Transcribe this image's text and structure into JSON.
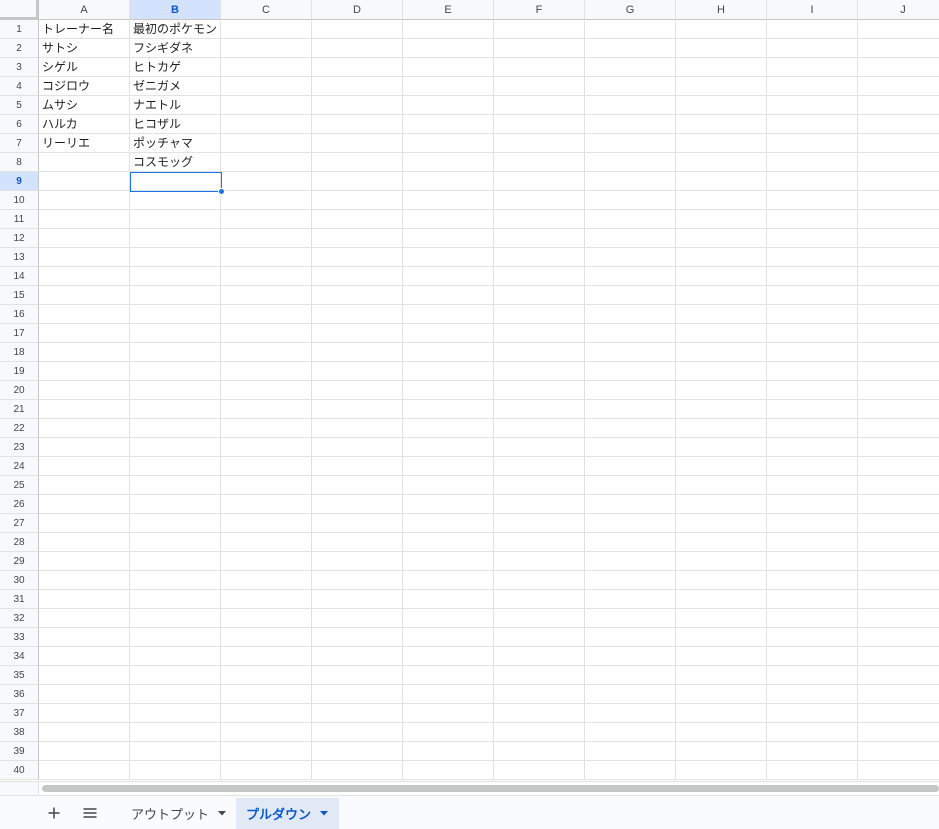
{
  "columns": [
    "A",
    "B",
    "C",
    "D",
    "E",
    "F",
    "G",
    "H",
    "I",
    "J"
  ],
  "selected_column": "B",
  "selected_row": 9,
  "row_count": 40,
  "cells": {
    "A1": "トレーナー名",
    "B1": "最初のポケモン",
    "A2": "サトシ",
    "B2": "フシギダネ",
    "A3": "シゲル",
    "B3": "ヒトカゲ",
    "A4": "コジロウ",
    "B4": "ゼニガメ",
    "A5": "ムサシ",
    "B5": "ナエトル",
    "A6": "ハルカ",
    "B6": "ヒコザル",
    "A7": "リーリエ",
    "B7": "ポッチャマ",
    "B8": "コスモッグ"
  },
  "tabs": [
    {
      "label": "アウトプット",
      "active": false
    },
    {
      "label": "プルダウン",
      "active": true
    }
  ],
  "icons": {
    "add_sheet": "plus-icon",
    "all_sheets": "menu-icon",
    "tab_caret": "caret-down-icon"
  },
  "colors": {
    "accent": "#1a73e8",
    "selected_header_bg": "#d3e3fd",
    "active_tab_bg": "#e1e9f7",
    "active_tab_text": "#0b57d0"
  }
}
